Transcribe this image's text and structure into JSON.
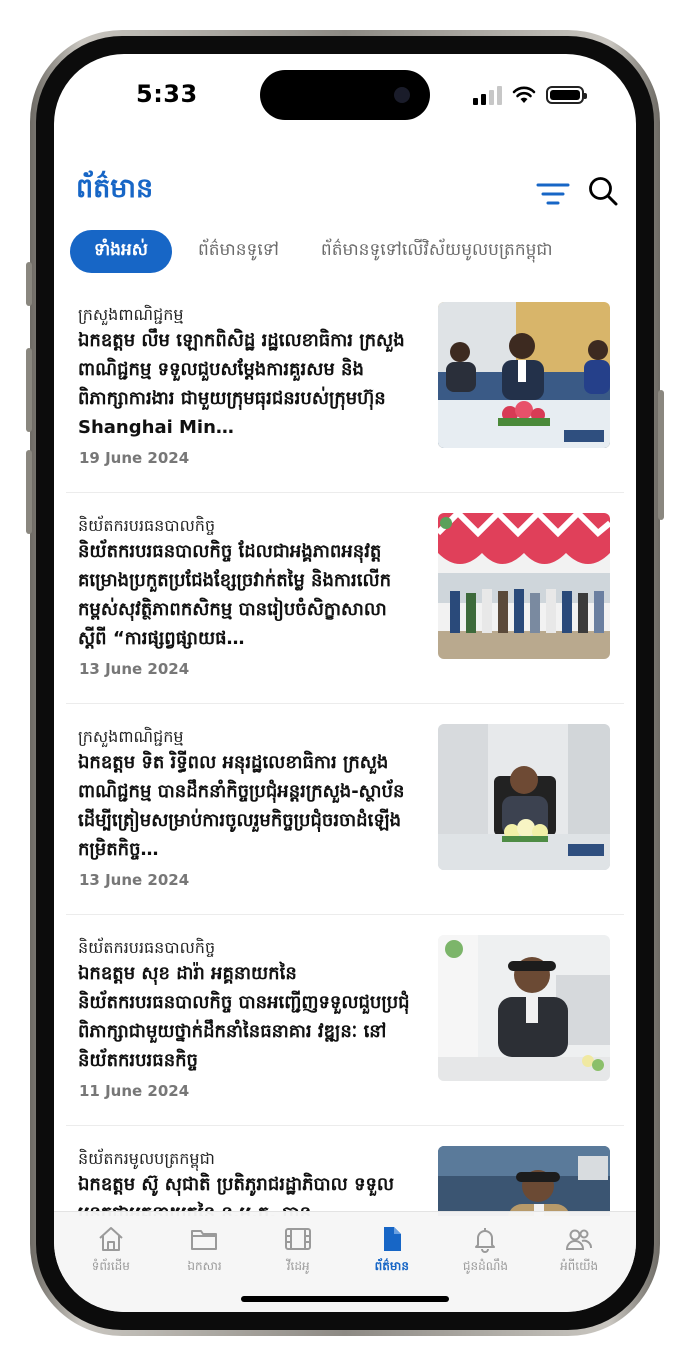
{
  "status": {
    "time": "5:33"
  },
  "header": {
    "title": "ព័ត៌មាន"
  },
  "tabs": [
    {
      "label": "ទាំងអស់",
      "active": true
    },
    {
      "label": "ព័ត៌មានទូទៅ",
      "active": false
    },
    {
      "label": "ព័ត៌មានទូទៅលើវិស័យមូលបត្រកម្ពុជា",
      "active": false
    }
  ],
  "articles": [
    {
      "category": "ក្រសួងពាណិជ្ជកម្ម",
      "headline": "ឯកឧត្តម លឹម ឡោកពិសិដ្ឋ រដ្ឋលេខាធិការ ក្រសួងពាណិជ្ជកម្ម ទទួលជួបសម្ដែងការគួរសម និងពិភាក្សាការងារ ជាមួយក្រុមធុរជនរបស់ក្រុមហ៊ុន Shanghai Min…",
      "date": "19 June 2024"
    },
    {
      "category": "និយ័តករបរធនបាលកិច្ច",
      "headline": "និយ័តករបរធនបាលកិច្ច ដែលជាអង្គភាពអនុវត្តគម្រោងប្រកួតប្រជែងខ្សែច្រវាក់តម្លៃ និងការលើកកម្ពស់សុវត្ថិភាពកសិកម្ម បានរៀបចំសិក្ខាសាលាស្ដីពី “ការផ្សព្វផ្សាយផ…",
      "date": "13 June 2024"
    },
    {
      "category": "ក្រសួងពាណិជ្ជកម្ម",
      "headline": "ឯកឧត្តម ទិត រិទ្ធីពល អនុរដ្ឋលេខាធិការ ក្រសួងពាណិជ្ជកម្ម បានដឹកនាំកិច្ចប្រជុំអន្តរក្រសួង-ស្ថាប័ន ដើម្បីត្រៀមសម្រាប់ការចូលរួមកិច្ចប្រជុំចរចាដំឡើងកម្រិតកិច្ច…",
      "date": "13 June 2024"
    },
    {
      "category": "និយ័តករបរធនបាលកិច្ច",
      "headline": "ឯកឧត្តម សុខ ដារ៉ា អគ្គនាយកនៃនិយ័តករបរធនបាលកិច្ច បានអញ្ជើញទទួលជួបប្រជុំពិភាក្សាជាមួយថ្នាក់ដឹកនាំនៃធនាគារ វឌ្ឍនៈ នៅនិយ័តករបរធនកិច្ច",
      "date": "11 June 2024"
    },
    {
      "category": "និយ័តករមូលបត្រកម្ពុជា",
      "headline": "ឯកឧត្តម ស៊ូ សុជាតិ ប្រតិភូរាជរដ្ឋាភិបាល ទទួលបន្ទុកជាអគ្គនាយកនៃ ន.ម.ក. បាន",
      "date": ""
    }
  ],
  "tabbar": [
    {
      "label": "ទំព័រដើម",
      "icon": "home-icon",
      "active": false
    },
    {
      "label": "ឯកសារ",
      "icon": "folder-icon",
      "active": false
    },
    {
      "label": "វីដេអូ",
      "icon": "film-icon",
      "active": false
    },
    {
      "label": "ព័ត៌មាន",
      "icon": "document-icon",
      "active": true
    },
    {
      "label": "ជូនដំណឹង",
      "icon": "bell-icon",
      "active": false
    },
    {
      "label": "អំពីយើង",
      "icon": "users-icon",
      "active": false
    }
  ],
  "colors": {
    "accent": "#1766c6",
    "inactive": "#9a9a9a"
  }
}
